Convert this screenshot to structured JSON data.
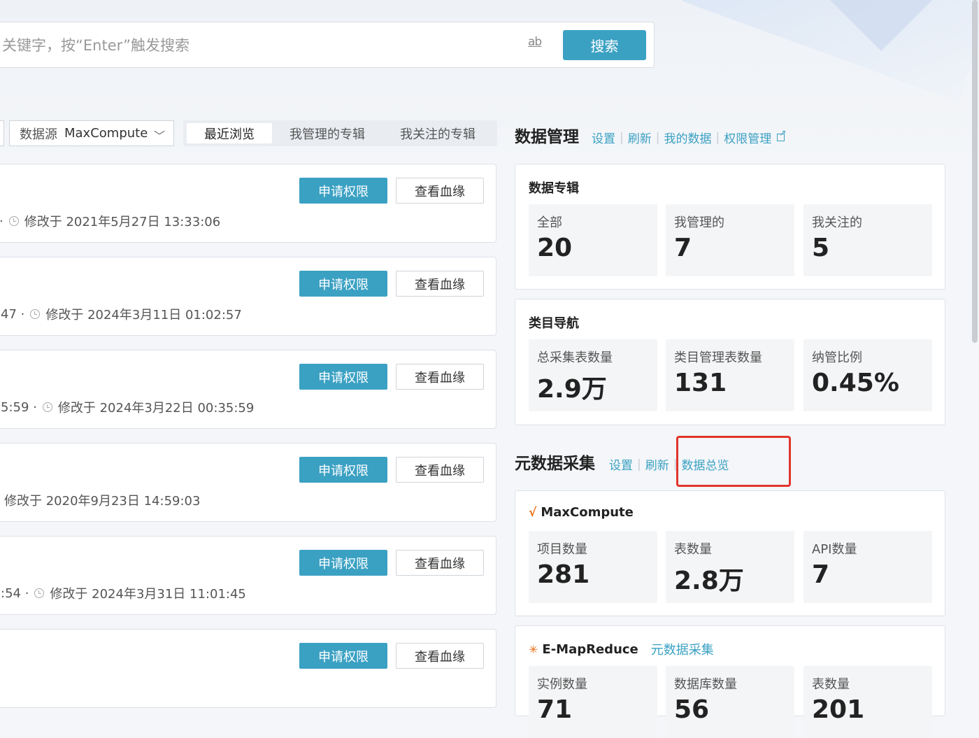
{
  "search": {
    "placeholder": "关键字，按“Enter”触发搜索",
    "match_case_icon_label": "ab",
    "button_label": "搜索"
  },
  "filters": {
    "datasource_label": "数据源",
    "datasource_value": "MaxCompute",
    "tabs": [
      "最近浏览",
      "我管理的专辑",
      "我关注的专辑"
    ],
    "active_tab": "最近浏览"
  },
  "list": {
    "apply_label": "申请权限",
    "lineage_label": "查看血缘",
    "items": [
      {
        "prefix": "·",
        "modified": "修改于 2021年5月27日 13:33:06"
      },
      {
        "prefix": "47 ·",
        "modified": "修改于 2024年3月11日 01:02:57"
      },
      {
        "prefix": "5:59 ·",
        "modified": "修改于 2024年3月22日 00:35:59"
      },
      {
        "prefix": "",
        "modified": "修改于 2020年9月23日 14:59:03"
      },
      {
        "prefix": ":54 ·",
        "modified": "修改于 2024年3月31日 11:01:45"
      },
      {
        "prefix": "",
        "modified": ""
      }
    ]
  },
  "data_management": {
    "title": "数据管理",
    "links": [
      "设置",
      "刷新",
      "我的数据",
      "权限管理"
    ],
    "albums": {
      "title": "数据专辑",
      "stats": [
        {
          "label": "全部",
          "value": "20"
        },
        {
          "label": "我管理的",
          "value": "7"
        },
        {
          "label": "我关注的",
          "value": "5"
        }
      ]
    },
    "category_nav": {
      "title": "类目导航",
      "stats": [
        {
          "label": "总采集表数量",
          "value": "2.9万"
        },
        {
          "label": "类目管理表数量",
          "value": "131"
        },
        {
          "label": "纳管比例",
          "value": "0.45%"
        }
      ]
    }
  },
  "metadata_collection": {
    "title": "元数据采集",
    "links": [
      "设置",
      "刷新",
      "数据总览"
    ],
    "maxcompute": {
      "title": "MaxCompute",
      "stats": [
        {
          "label": "项目数量",
          "value": "281"
        },
        {
          "label": "表数量",
          "value": "2.8万"
        },
        {
          "label": "API数量",
          "value": "7"
        }
      ]
    },
    "emr": {
      "title": "E-MapReduce",
      "link": "元数据采集",
      "stats": [
        {
          "label": "实例数量",
          "value": "71"
        },
        {
          "label": "数据库数量",
          "value": "56"
        },
        {
          "label": "表数量",
          "value": "201"
        }
      ]
    }
  },
  "colors": {
    "accent": "#3ba1c3",
    "highlight": "#e2352c"
  }
}
